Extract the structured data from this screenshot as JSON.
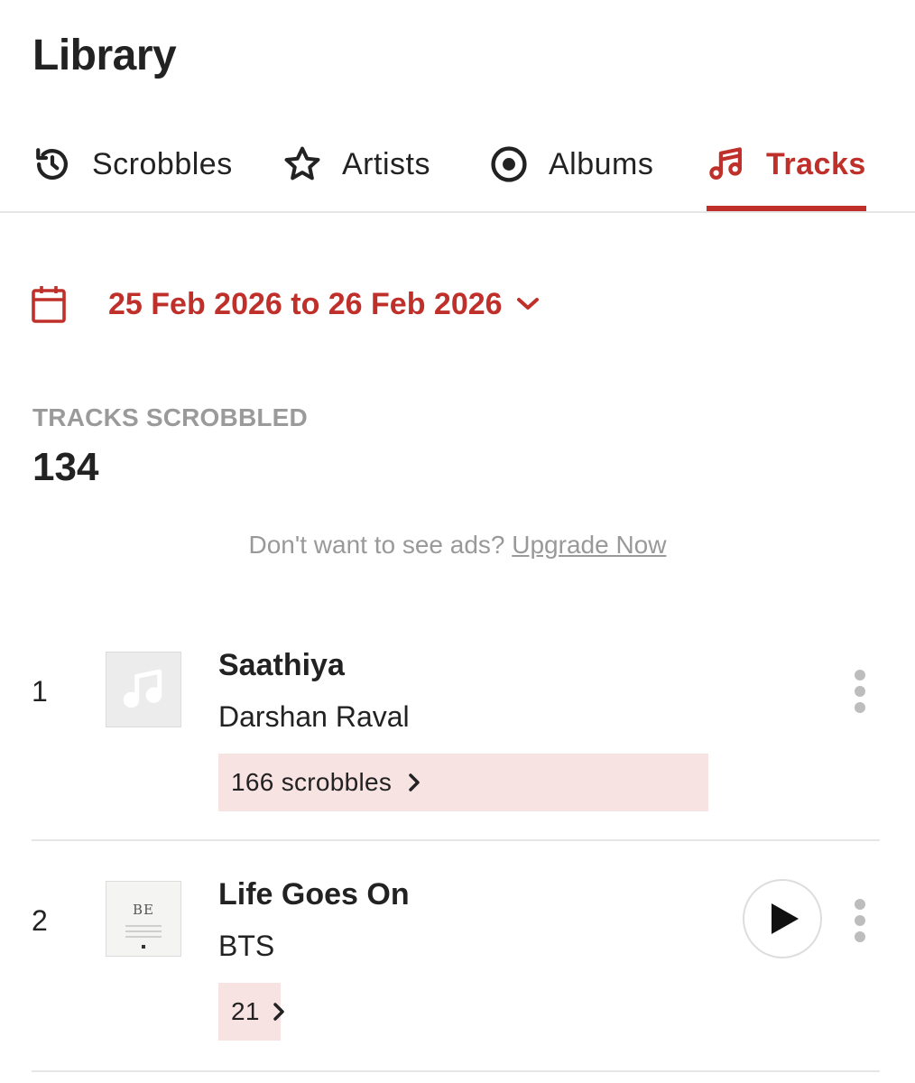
{
  "page": {
    "title": "Library"
  },
  "tabs": [
    {
      "label": "Scrobbles",
      "icon": "history-icon",
      "active": false
    },
    {
      "label": "Artists",
      "icon": "star-icon",
      "active": false
    },
    {
      "label": "Albums",
      "icon": "album-disc-icon",
      "active": false
    },
    {
      "label": "Tracks",
      "icon": "music-note-icon",
      "active": true
    }
  ],
  "date_range": {
    "label": "25 Feb 2026 to 26 Feb 2026",
    "icon": "calendar-icon"
  },
  "stats": {
    "label": "TRACKS SCROBBLED",
    "value": "134"
  },
  "ad_note": {
    "text": "Don't want to see ads?",
    "link": "Upgrade Now"
  },
  "tracks": [
    {
      "rank": "1",
      "name": "Saathiya",
      "artist": "Darshan Raval",
      "scrobbles": "166 scrobbles",
      "has_play": false,
      "art": "music-note-placeholder-icon"
    },
    {
      "rank": "2",
      "name": "Life Goes On",
      "artist": "BTS",
      "scrobbles": "21",
      "has_play": true,
      "art_text": "BE"
    }
  ],
  "colors": {
    "accent": "#c0302b",
    "scrobble_bg": "#f7e3e2",
    "muted_text": "#999999"
  }
}
